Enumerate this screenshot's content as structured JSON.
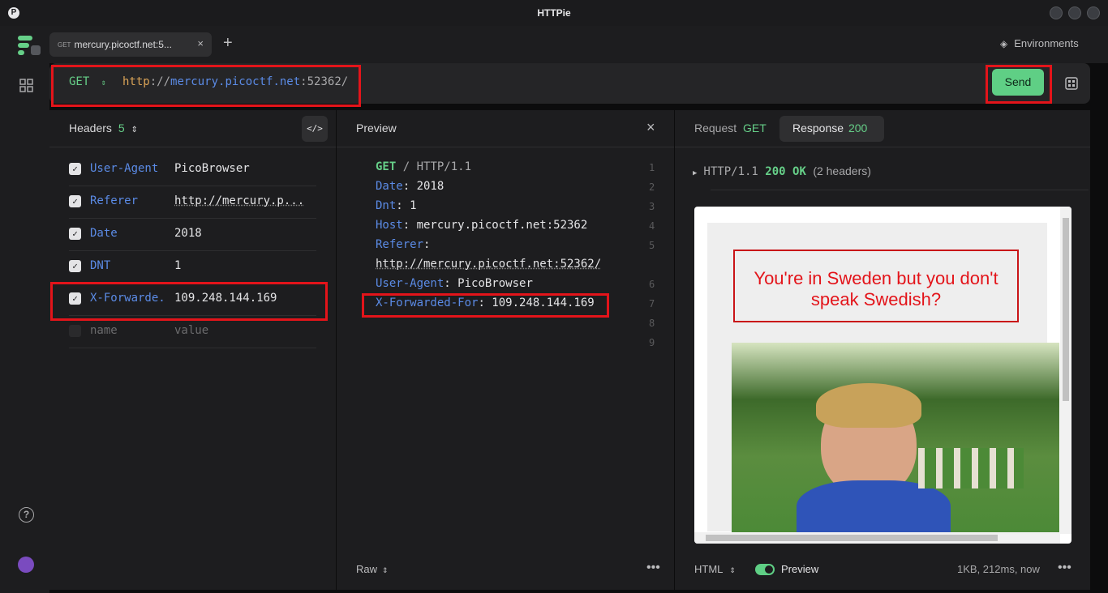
{
  "window": {
    "title": "HTTPie"
  },
  "tab": {
    "method": "GET",
    "title": "mercury.picoctf.net:5..."
  },
  "environments_label": "Environments",
  "request": {
    "method": "GET",
    "url_scheme": "http",
    "url_sep": "://",
    "url_host": "mercury.picoctf.net",
    "url_rest": ":52362/",
    "send_label": "Send"
  },
  "headers_panel": {
    "title": "Headers",
    "count": "5",
    "rows": [
      {
        "key": "User-Agent",
        "value": "PicoBrowser"
      },
      {
        "key": "Referer",
        "value": "http://mercury.p..."
      },
      {
        "key": "Date",
        "value": "2018"
      },
      {
        "key": "DNT",
        "value": "1"
      },
      {
        "key": "X-Forwarde...",
        "value": "109.248.144.169"
      }
    ],
    "placeholder_key": "name",
    "placeholder_value": "value"
  },
  "preview_panel": {
    "title": "Preview",
    "lines": {
      "l1_method": "GET",
      "l1_path": " / HTTP/1.1",
      "l2_key": "Date",
      "l2_val": ": 2018",
      "l3_key": "Dnt",
      "l3_val": ": 1",
      "l4_key": "Host",
      "l4_val": ": mercury.picoctf.net:52362",
      "l5_key": "Referer",
      "l5_val": ":",
      "l5b": "http://mercury.picoctf.net:52362/",
      "l6_key": "User-Agent",
      "l6_val": ": PicoBrowser",
      "l7_key": "X-Forwarded-For",
      "l7_val": ": 109.248.144.169"
    },
    "line_numbers": [
      "1",
      "2",
      "3",
      "4",
      "5",
      "6",
      "7",
      "8",
      "9"
    ],
    "raw_label": "Raw"
  },
  "response_panel": {
    "tab_request": "Request",
    "tab_request_method": "GET",
    "tab_response": "Response",
    "tab_response_code": "200",
    "status_proto": "HTTP/1.1",
    "status_code": "200 OK",
    "status_headers": "(2 headers)",
    "page_message": "You're in Sweden but you don't speak Swedish?",
    "format_label": "HTML",
    "preview_label": "Preview",
    "meta": "1KB, 212ms, now"
  }
}
